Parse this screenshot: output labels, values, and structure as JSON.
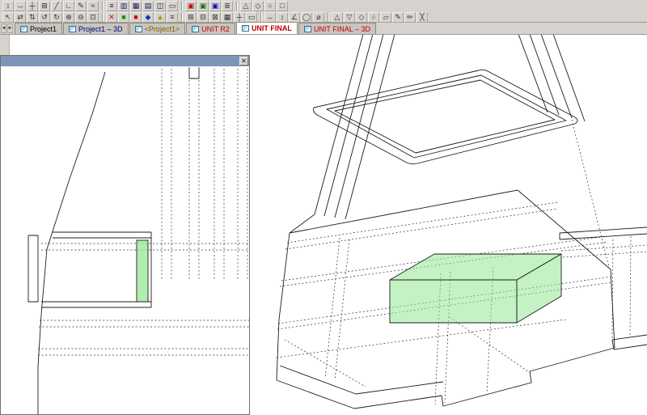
{
  "colors": {
    "chrome_bg": "#d6d3ce",
    "panel_titlebar": "#7b96b8",
    "highlight_fill": "#94e894",
    "highlight_stroke": "#1f7a1f",
    "wire_solid": "#1c1c1c",
    "wire_hidden": "#2e2e2e",
    "tab_red": "#c00000"
  },
  "toolbar": {
    "row1": [
      {
        "name": "snap-vertical",
        "glyph": "↕",
        "color": "#333333"
      },
      {
        "name": "snap-horizontal",
        "glyph": "↔",
        "color": "#333333"
      },
      {
        "name": "snap-cross",
        "glyph": "┼",
        "color": "#333333"
      },
      {
        "name": "snap-grid",
        "glyph": "⊞",
        "color": "#333333"
      },
      {
        "name": "draw-line",
        "glyph": "╱",
        "color": "#333333"
      },
      {
        "name": "draw-corner",
        "glyph": "∟",
        "color": "#333333"
      },
      {
        "name": "draw-pencil",
        "glyph": "✎",
        "color": "#333333"
      },
      {
        "name": "draw-curve",
        "glyph": "≈",
        "color": "#333333"
      },
      {
        "sep": true
      },
      {
        "name": "view-list",
        "glyph": "≡",
        "color": "#1a1a5e"
      },
      {
        "name": "view-columns",
        "glyph": "▥",
        "color": "#1a1a5e"
      },
      {
        "name": "view-grid",
        "glyph": "▦",
        "color": "#1a1a5e"
      },
      {
        "name": "view-rows",
        "glyph": "▤",
        "color": "#1a1a5e"
      },
      {
        "name": "view-split",
        "glyph": "◫",
        "color": "#1a1a5e"
      },
      {
        "name": "view-frame",
        "glyph": "▭",
        "color": "#1a1a5e"
      },
      {
        "sep": true
      },
      {
        "name": "layer-red",
        "glyph": "▣",
        "color": "#bb1111"
      },
      {
        "name": "layer-green",
        "glyph": "▣",
        "color": "#117711"
      },
      {
        "name": "layer-blue",
        "glyph": "▣",
        "color": "#1111bb"
      },
      {
        "name": "layer-list",
        "glyph": "≣",
        "color": "#333333"
      },
      {
        "sep": true
      },
      {
        "name": "shape-triangle",
        "glyph": "△",
        "color": "#333333"
      },
      {
        "name": "shape-diamond",
        "glyph": "◇",
        "color": "#333333"
      },
      {
        "name": "shape-circle",
        "glyph": "○",
        "color": "#333333"
      },
      {
        "name": "shape-square",
        "glyph": "□",
        "color": "#333333"
      }
    ],
    "row2": [
      {
        "name": "select-pointer",
        "glyph": "↖",
        "color": "#333333"
      },
      {
        "name": "pan-horizontal",
        "glyph": "⇄",
        "color": "#333333"
      },
      {
        "name": "pan-vertical",
        "glyph": "⇅",
        "color": "#333333"
      },
      {
        "name": "rotate-left",
        "glyph": "↺",
        "color": "#333333"
      },
      {
        "name": "rotate-right",
        "glyph": "↻",
        "color": "#333333"
      },
      {
        "name": "zoom-in",
        "glyph": "⊕",
        "color": "#333333"
      },
      {
        "name": "zoom-out",
        "glyph": "⊖",
        "color": "#333333"
      },
      {
        "name": "zoom-window",
        "glyph": "⊡",
        "color": "#333333"
      },
      {
        "sep": true
      },
      {
        "name": "delete-mark",
        "glyph": "✕",
        "color": "#bb1111"
      },
      {
        "name": "status-green",
        "glyph": "■",
        "color": "#119911"
      },
      {
        "name": "status-red",
        "glyph": "■",
        "color": "#bb1111"
      },
      {
        "name": "status-blue",
        "glyph": "◆",
        "color": "#1133bb"
      },
      {
        "name": "status-warn",
        "glyph": "▲",
        "color": "#bb8800"
      },
      {
        "name": "properties-list",
        "glyph": "≡",
        "color": "#333333"
      },
      {
        "sep": true
      },
      {
        "name": "table-add",
        "glyph": "⊞",
        "color": "#333333"
      },
      {
        "name": "table-remove",
        "glyph": "⊟",
        "color": "#333333"
      },
      {
        "name": "table-close",
        "glyph": "⊠",
        "color": "#333333"
      },
      {
        "name": "grid-toggle",
        "glyph": "▦",
        "color": "#333333"
      },
      {
        "name": "axes-toggle",
        "glyph": "┼",
        "color": "#333333"
      },
      {
        "name": "frame-toggle",
        "glyph": "▭",
        "color": "#333333"
      },
      {
        "sep": true
      },
      {
        "name": "dim-horizontal",
        "glyph": "↔",
        "color": "#333333"
      },
      {
        "name": "dim-vertical",
        "glyph": "↕",
        "color": "#333333"
      },
      {
        "name": "dim-angle",
        "glyph": "∠",
        "color": "#333333"
      },
      {
        "name": "dim-radius",
        "glyph": "◯",
        "color": "#333333"
      },
      {
        "name": "dim-diameter",
        "glyph": "⌀",
        "color": "#333333"
      },
      {
        "sep": true
      },
      {
        "name": "tool-triangle",
        "glyph": "△",
        "color": "#333333"
      },
      {
        "name": "tool-invert-triangle",
        "glyph": "▽",
        "color": "#333333"
      },
      {
        "name": "tool-diamond",
        "glyph": "◇",
        "color": "#333333"
      },
      {
        "name": "tool-circle",
        "glyph": "○",
        "color": "#333333"
      },
      {
        "name": "tool-parallelogram",
        "glyph": "▱",
        "color": "#333333"
      },
      {
        "name": "tool-pencil",
        "glyph": "✎",
        "color": "#333333"
      },
      {
        "name": "tool-pen",
        "glyph": "✏",
        "color": "#333333"
      },
      {
        "name": "tool-cross",
        "glyph": "╳",
        "color": "#333333"
      }
    ]
  },
  "tab_bar": {
    "scroll_buttons": [
      {
        "name": "tab-scroll-left",
        "glyph": "◄"
      },
      {
        "name": "tab-scroll-right",
        "glyph": "►"
      }
    ],
    "tabs": [
      {
        "label": "Project1",
        "color": "#000000",
        "active": false
      },
      {
        "label": "Project1 – 3D",
        "color": "#000080",
        "active": false
      },
      {
        "label": "<Project1>",
        "color": "#806000",
        "active": false
      },
      {
        "label": "UNIT R2",
        "color": "#c00000",
        "active": false
      },
      {
        "label": "UNIT FINAL",
        "color": "#c00000",
        "active": true
      },
      {
        "label": "UNIT FINAL – 3D",
        "color": "#c00000",
        "active": false
      }
    ]
  },
  "panel": {
    "close_glyph": "✕"
  }
}
